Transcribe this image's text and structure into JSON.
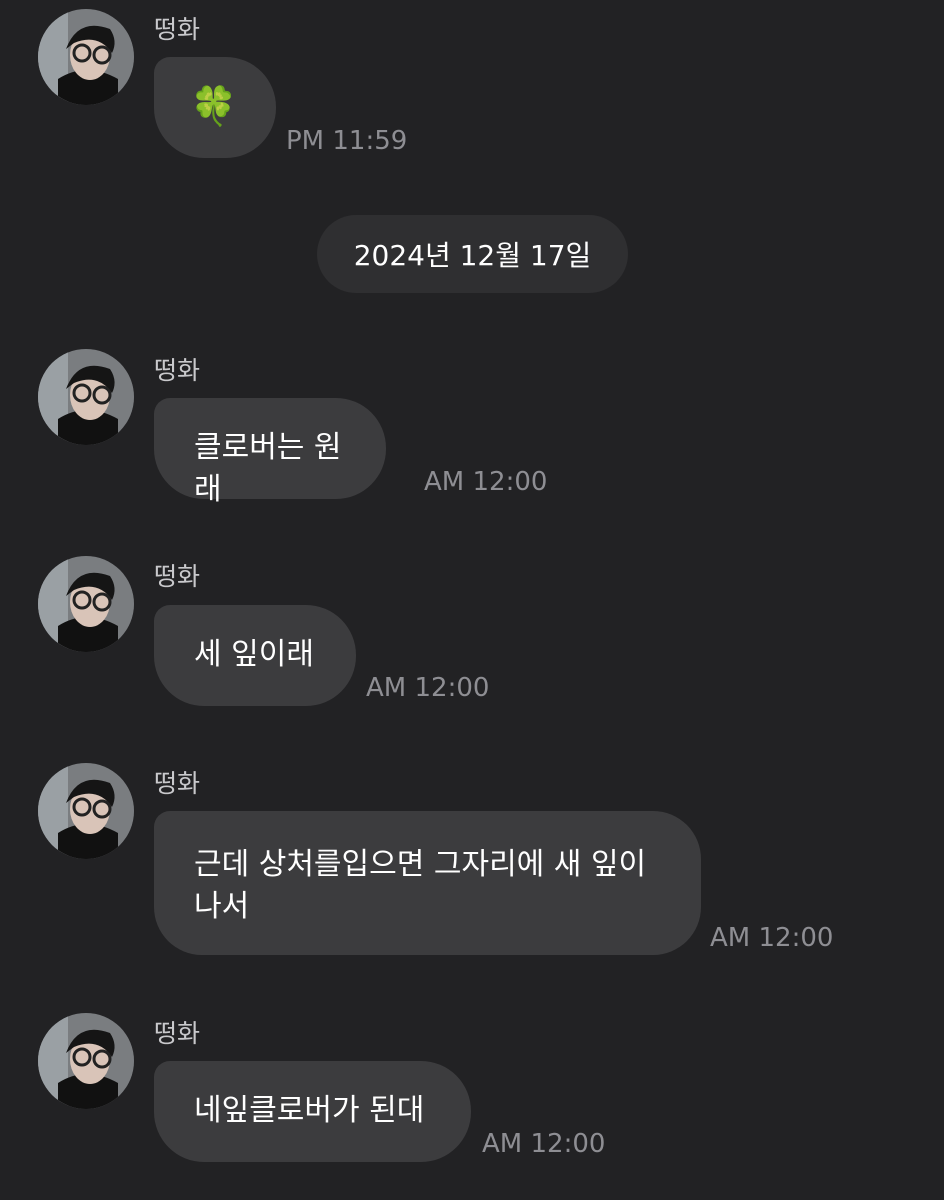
{
  "date_divider": "2024년 12월 17일",
  "messages": [
    {
      "sender": "떵화",
      "text": "🍀",
      "time": "PM 11:59"
    },
    {
      "sender": "떵화",
      "text": "클로버는 원래",
      "time": "AM 12:00"
    },
    {
      "sender": "떵화",
      "text": "세 잎이래",
      "time": "AM 12:00"
    },
    {
      "sender": "떵화",
      "lines": [
        "근데 상처를입으면 그자리에 새 잎이",
        "나서"
      ],
      "time": "AM 12:00"
    },
    {
      "sender": "떵화",
      "text": "네잎클로버가 된대",
      "time": "AM 12:00"
    }
  ],
  "icons": {
    "avatar": "profile-photo-avatar",
    "clover": "four-leaf-clover-emoji"
  },
  "colors": {
    "background": "#222224",
    "bubble": "#3c3c3e",
    "date_pill": "#2f2f31",
    "time": "#8e8e93"
  }
}
